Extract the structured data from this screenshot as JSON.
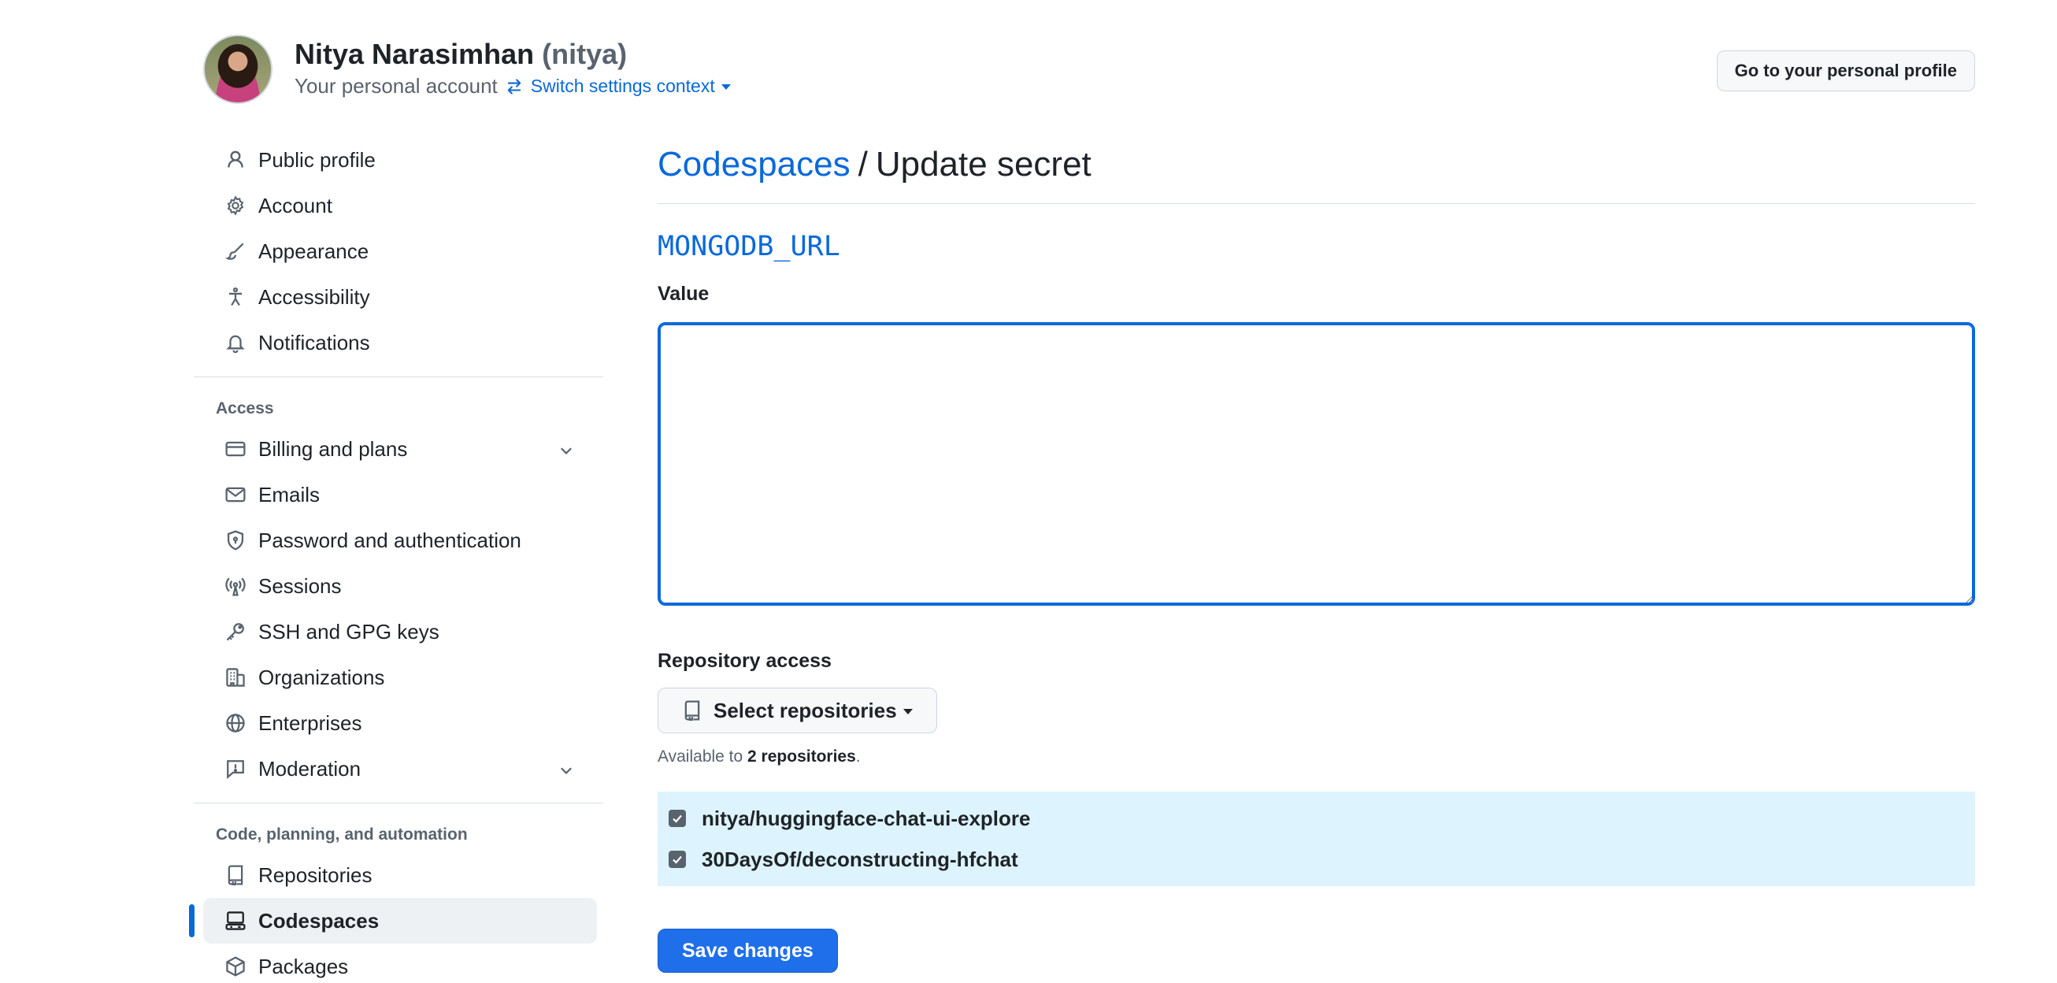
{
  "header": {
    "display_name": "Nitya Narasimhan",
    "login": "(nitya)",
    "account_label": "Your personal account",
    "switch_context": "Switch settings context",
    "profile_button": "Go to your personal profile"
  },
  "sidebar": {
    "group1": [
      {
        "label": "Public profile",
        "icon": "person-icon"
      },
      {
        "label": "Account",
        "icon": "gear-icon"
      },
      {
        "label": "Appearance",
        "icon": "paintbrush-icon"
      },
      {
        "label": "Accessibility",
        "icon": "accessibility-icon"
      },
      {
        "label": "Notifications",
        "icon": "bell-icon"
      }
    ],
    "access_heading": "Access",
    "group2": [
      {
        "label": "Billing and plans",
        "icon": "credit-card-icon",
        "expandable": true
      },
      {
        "label": "Emails",
        "icon": "mail-icon"
      },
      {
        "label": "Password and authentication",
        "icon": "shield-lock-icon"
      },
      {
        "label": "Sessions",
        "icon": "broadcast-icon"
      },
      {
        "label": "SSH and GPG keys",
        "icon": "key-icon"
      },
      {
        "label": "Organizations",
        "icon": "organization-icon"
      },
      {
        "label": "Enterprises",
        "icon": "globe-icon"
      },
      {
        "label": "Moderation",
        "icon": "report-icon",
        "expandable": true
      }
    ],
    "code_heading": "Code, planning, and automation",
    "group3": [
      {
        "label": "Repositories",
        "icon": "repo-icon"
      },
      {
        "label": "Codespaces",
        "icon": "codespaces-icon",
        "active": true
      },
      {
        "label": "Packages",
        "icon": "package-icon"
      }
    ]
  },
  "main": {
    "breadcrumb_link": "Codespaces",
    "breadcrumb_sep": "/",
    "page_title": "Update secret",
    "secret_name": "MONGODB_URL",
    "value_label": "Value",
    "value_text": "",
    "repo_access_label": "Repository access",
    "select_repos_label": "Select repositories",
    "available_prefix": "Available to",
    "available_count": "2 repositories",
    "available_suffix": ".",
    "repos": [
      {
        "name": "nitya/huggingface-chat-ui-explore",
        "checked": true
      },
      {
        "name": "30DaysOf/deconstructing-hfchat",
        "checked": true
      }
    ],
    "save_label": "Save changes"
  },
  "colors": {
    "accent": "#0969da",
    "primary_button": "#1f6feb",
    "selected_list_bg": "#ddf4ff",
    "muted_text": "#59636e"
  }
}
